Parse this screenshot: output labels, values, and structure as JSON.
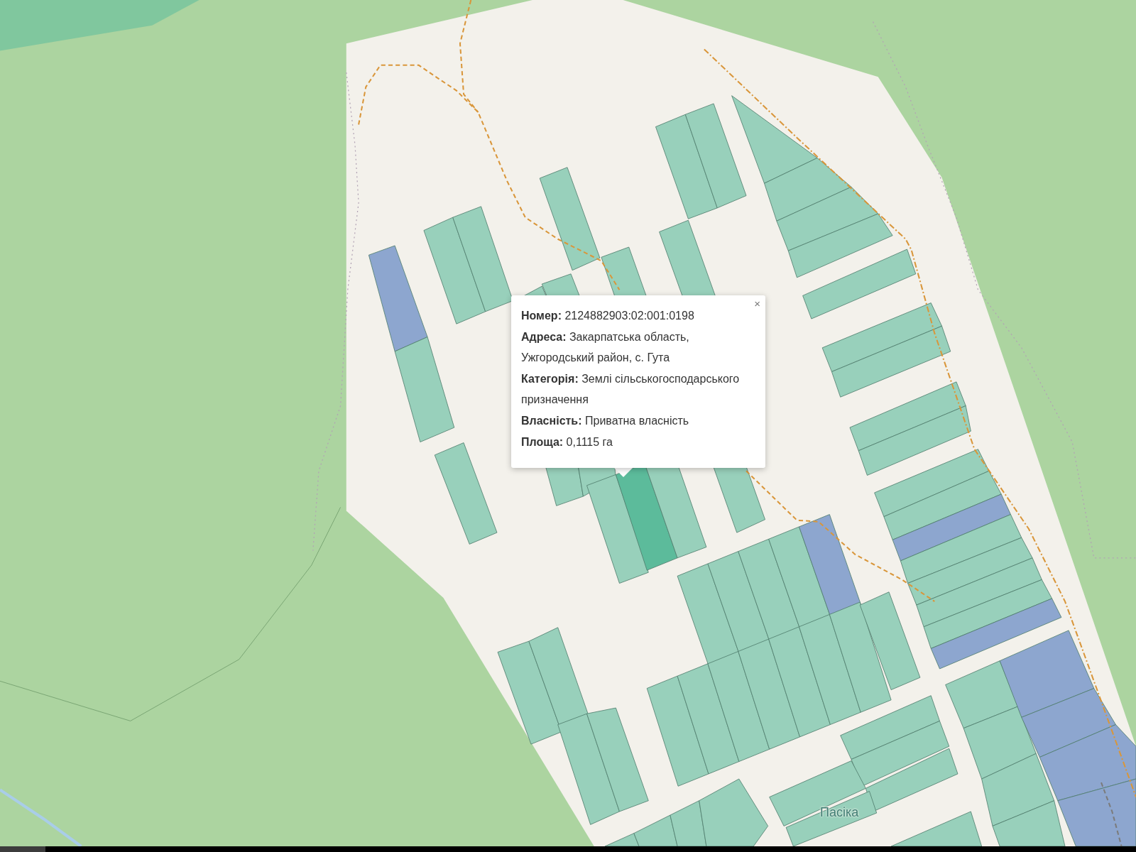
{
  "map": {
    "place_label": "Пасіка"
  },
  "popup": {
    "close": "×",
    "lines": [
      "**Номер:** 2124882903:02:001:0198",
      "**Адреса:** Закарпатська область, Ужгородський район, с. Гута",
      "**Категорія:** Землі сільськогосподарського призначення",
      "**Власність:** Приватна власність",
      "**Площа:** 0,1115 га"
    ]
  },
  "player": {
    "progress": {
      "level": 0.04
    }
  }
}
